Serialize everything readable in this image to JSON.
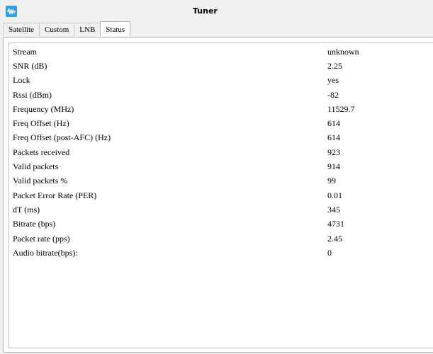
{
  "window": {
    "title": "Tuner",
    "icon": "waveform-icon"
  },
  "tabs": [
    {
      "label": "Satellite"
    },
    {
      "label": "Custom"
    },
    {
      "label": "LNB"
    },
    {
      "label": "Status",
      "active": true
    }
  ],
  "status": {
    "rows": [
      {
        "label": "Stream",
        "value": "unknown"
      },
      {
        "label": "SNR (dB)",
        "value": "2.25"
      },
      {
        "label": "Lock",
        "value": "yes"
      },
      {
        "label": "Rssi (dBm)",
        "value": "-82"
      },
      {
        "label": "Frequency (MHz)",
        "value": "11529.7"
      },
      {
        "label": "Freq Offset (Hz)",
        "value": "614"
      },
      {
        "label": "Freq Offset (post-AFC) (Hz)",
        "value": "614"
      },
      {
        "label": "Packets received",
        "value": "923"
      },
      {
        "label": "Valid packets",
        "value": "914"
      },
      {
        "label": "Valid packets %",
        "value": "99"
      },
      {
        "label": "Packet Error Rate (PER)",
        "value": "0.01"
      },
      {
        "label": "dT (ms)",
        "value": "345"
      },
      {
        "label": "Bitrate (bps)",
        "value": "4731"
      },
      {
        "label": "Packet rate (pps)",
        "value": "2.45"
      },
      {
        "label": "Audio bitrate(bps):",
        "value": "0"
      }
    ]
  }
}
